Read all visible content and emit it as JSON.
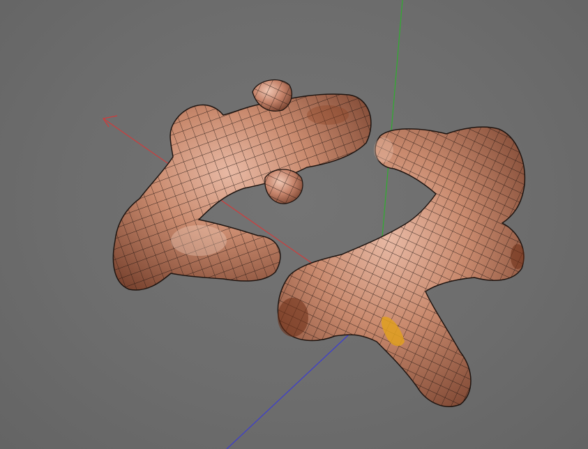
{
  "viewport": {
    "background_color": "#6b6b6b",
    "grid_visible": false
  },
  "axes": {
    "x_axis_color": "#d13b3b",
    "y_axis_color": "#2fae2f",
    "z_axis_color": "#3b3bd1"
  },
  "model": {
    "render_mode": "textured-wireframe",
    "skin_color": "#c98a6e",
    "wire_color": "#1e1410",
    "objects": [
      "ginger-root-left",
      "ginger-root-right"
    ]
  }
}
